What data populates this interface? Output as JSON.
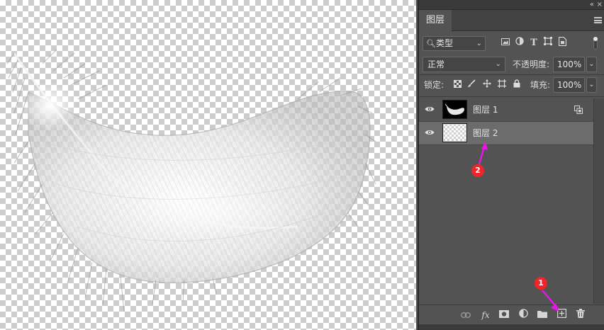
{
  "panel": {
    "tab_label": "图层",
    "collapse_glyph": "«",
    "close_glyph": "×"
  },
  "filter": {
    "kind_label": "类型",
    "icons": [
      "image-filter-icon",
      "adjustment-filter-icon",
      "type-filter-icon",
      "shape-filter-icon",
      "smart-object-filter-icon"
    ]
  },
  "blend": {
    "mode": "正常",
    "opacity_label": "不透明度:",
    "opacity_value": "100%"
  },
  "lock": {
    "label": "锁定:",
    "fill_label": "填充:",
    "fill_value": "100%",
    "icons": [
      "lock-transparent-pixels-icon",
      "lock-image-pixels-icon",
      "lock-position-icon",
      "lock-artboard-icon",
      "lock-all-icon"
    ]
  },
  "layers": [
    {
      "name": "图层 1",
      "visible": true,
      "selected": false,
      "thumbnail": "feather"
    },
    {
      "name": "图层 2",
      "visible": true,
      "selected": true,
      "thumbnail": "transparent"
    }
  ],
  "bottom_toolbar": {
    "fx_label": "fx",
    "icons": [
      "link-layers-icon",
      "layer-style-icon",
      "add-mask-icon",
      "adjustment-layer-icon",
      "new-group-icon",
      "new-layer-icon",
      "delete-layer-icon"
    ]
  },
  "annotations": {
    "marker_1": "1",
    "marker_2": "2"
  },
  "colors": {
    "annotation_red": "#f0242a",
    "annotation_arrow": "#e616e6",
    "panel_bg": "#535353",
    "selected_row": "#6c6c6c"
  }
}
